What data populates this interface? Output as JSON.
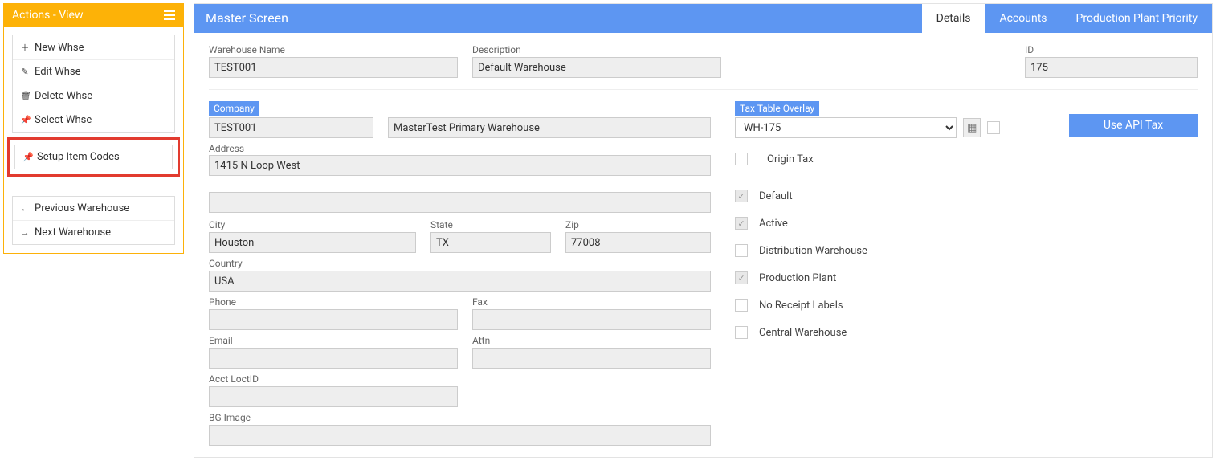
{
  "actions": {
    "title": "Actions - View",
    "group1": [
      {
        "icon": "＋",
        "label": "New Whse"
      },
      {
        "icon": "✎",
        "label": "Edit Whse"
      },
      {
        "icon": "🗑",
        "label": "Delete Whse"
      },
      {
        "icon": "📌",
        "label": "Select Whse"
      }
    ],
    "highlight": {
      "icon": "📌",
      "label": "Setup Item Codes"
    },
    "group2": [
      {
        "icon": "←",
        "label": "Previous Warehouse"
      },
      {
        "icon": "→",
        "label": "Next Warehouse"
      }
    ]
  },
  "header": {
    "title": "Master Screen",
    "tabs": [
      {
        "label": "Details",
        "active": true
      },
      {
        "label": "Accounts",
        "active": false
      },
      {
        "label": "Production Plant Priority",
        "active": false
      }
    ]
  },
  "top": {
    "warehouse_name_label": "Warehouse Name",
    "warehouse_name": "TEST001",
    "description_label": "Description",
    "description": "Default Warehouse",
    "id_label": "ID",
    "id": "175"
  },
  "company": {
    "badge": "Company",
    "code": "TEST001",
    "name": "MasterTest Primary Warehouse",
    "address_label": "Address",
    "address1": "1415 N Loop West",
    "address2": "",
    "city_label": "City",
    "city": "Houston",
    "state_label": "State",
    "state": "TX",
    "zip_label": "Zip",
    "zip": "77008",
    "country_label": "Country",
    "country": "USA",
    "phone_label": "Phone",
    "phone": "",
    "fax_label": "Fax",
    "fax": "",
    "email_label": "Email",
    "email": "",
    "attn_label": "Attn",
    "attn": "",
    "acct_label": "Acct LoctID",
    "acct": "",
    "bg_label": "BG Image"
  },
  "tax": {
    "badge": "Tax Table Overlay",
    "select": "WH-175",
    "button": "Use API Tax",
    "origin_label": "Origin Tax"
  },
  "checks": [
    {
      "label": "Default",
      "on": true
    },
    {
      "label": "Active",
      "on": true
    },
    {
      "label": "Distribution Warehouse",
      "on": false
    },
    {
      "label": "Production Plant",
      "on": true
    },
    {
      "label": "No Receipt Labels",
      "on": false
    },
    {
      "label": "Central Warehouse",
      "on": false
    }
  ]
}
